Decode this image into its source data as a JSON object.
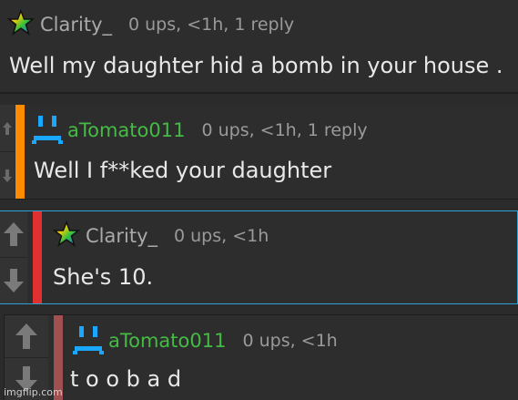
{
  "comments": [
    {
      "username": "Clarity_",
      "meta": "0 ups, <1h, 1 reply",
      "text": "Well my daughter hid a bomb in your house .",
      "user_color": "#aaaaaa",
      "bar_color": null,
      "icon": "rainbow-star-icon"
    },
    {
      "username": "aTomato011",
      "meta": "0 ups, <1h, 1 reply",
      "text": "Well I f**ked your daughter",
      "user_color": "#44bb44",
      "bar_color": "#ff8c00",
      "icon": "sad-face-icon"
    },
    {
      "username": "Clarity_",
      "meta": "0 ups, <1h",
      "text": "She's 10.",
      "user_color": "#aaaaaa",
      "bar_color": "#e03030",
      "icon": "rainbow-star-icon"
    },
    {
      "username": "aTomato011",
      "meta": "0 ups, <1h",
      "text": "t o o b a d",
      "user_color": "#44bb44",
      "bar_color": "#a05050",
      "icon": "sad-face-icon"
    }
  ],
  "watermark": "imgflip.com"
}
